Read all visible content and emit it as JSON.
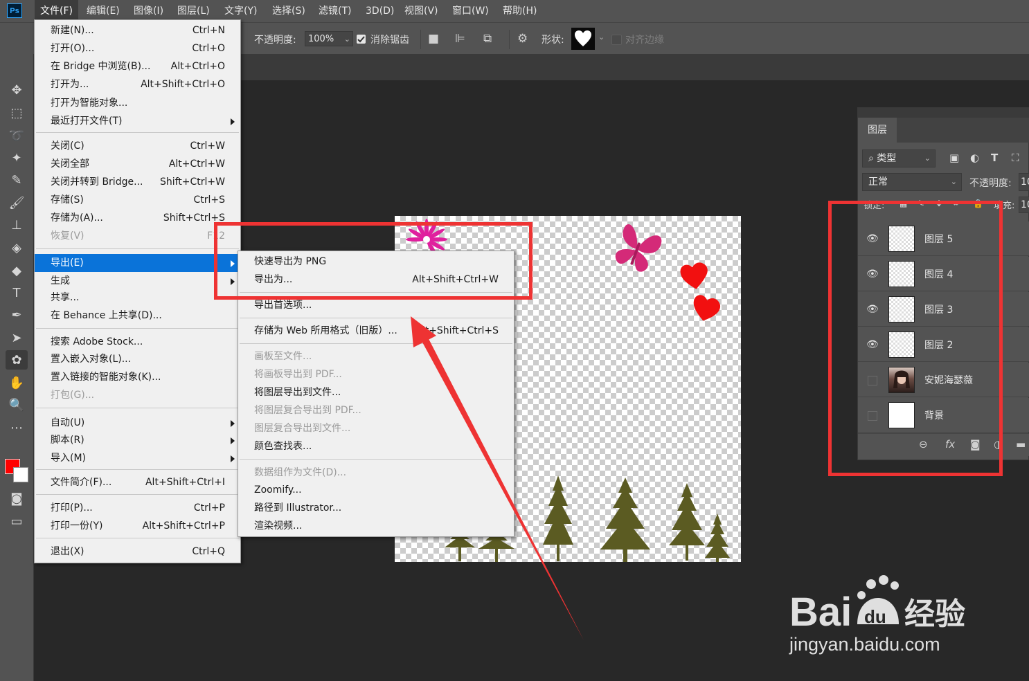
{
  "app": {
    "logo": "Ps"
  },
  "menubar": {
    "items": [
      {
        "label": "文件(F)"
      },
      {
        "label": "编辑(E)"
      },
      {
        "label": "图像(I)"
      },
      {
        "label": "图层(L)"
      },
      {
        "label": "文字(Y)"
      },
      {
        "label": "选择(S)"
      },
      {
        "label": "滤镜(T)"
      },
      {
        "label": "3D(D)"
      },
      {
        "label": "视图(V)"
      },
      {
        "label": "窗口(W)"
      },
      {
        "label": "帮助(H)"
      }
    ],
    "active_index": 0
  },
  "options_bar": {
    "opacity_label": "不透明度:",
    "opacity_value": "100%",
    "antialias_label": "消除锯齿",
    "antialias_checked": true,
    "shape_label": "形状:",
    "align_edges_label": "对齐边缘",
    "align_edges_checked": false
  },
  "file_menu": {
    "items": [
      {
        "label": "新建(N)...",
        "shortcut": "Ctrl+N"
      },
      {
        "label": "打开(O)...",
        "shortcut": "Ctrl+O"
      },
      {
        "label": "在 Bridge 中浏览(B)...",
        "shortcut": "Alt+Ctrl+O"
      },
      {
        "label": "打开为...",
        "shortcut": "Alt+Shift+Ctrl+O"
      },
      {
        "label": "打开为智能对象...",
        "shortcut": ""
      },
      {
        "label": "最近打开文件(T)",
        "shortcut": "",
        "submenu": true
      },
      {
        "label": "关闭(C)",
        "shortcut": "Ctrl+W"
      },
      {
        "label": "关闭全部",
        "shortcut": "Alt+Ctrl+W"
      },
      {
        "label": "关闭并转到 Bridge...",
        "shortcut": "Shift+Ctrl+W"
      },
      {
        "label": "存储(S)",
        "shortcut": "Ctrl+S"
      },
      {
        "label": "存储为(A)...",
        "shortcut": "Shift+Ctrl+S"
      },
      {
        "label": "恢复(V)",
        "shortcut": "F12",
        "disabled": true
      },
      {
        "label": "导出(E)",
        "shortcut": "",
        "submenu": true,
        "highlight": true
      },
      {
        "label": "生成",
        "shortcut": "",
        "submenu": true
      },
      {
        "label": "共享...",
        "shortcut": ""
      },
      {
        "label": "在 Behance 上共享(D)...",
        "shortcut": ""
      },
      {
        "label": "搜索 Adobe Stock...",
        "shortcut": ""
      },
      {
        "label": "置入嵌入对象(L)...",
        "shortcut": ""
      },
      {
        "label": "置入链接的智能对象(K)...",
        "shortcut": ""
      },
      {
        "label": "打包(G)...",
        "shortcut": "",
        "disabled": true
      },
      {
        "label": "自动(U)",
        "shortcut": "",
        "submenu": true
      },
      {
        "label": "脚本(R)",
        "shortcut": "",
        "submenu": true
      },
      {
        "label": "导入(M)",
        "shortcut": "",
        "submenu": true
      },
      {
        "label": "文件简介(F)...",
        "shortcut": "Alt+Shift+Ctrl+I"
      },
      {
        "label": "打印(P)...",
        "shortcut": "Ctrl+P"
      },
      {
        "label": "打印一份(Y)",
        "shortcut": "Alt+Shift+Ctrl+P"
      },
      {
        "label": "退出(X)",
        "shortcut": "Ctrl+Q"
      }
    ]
  },
  "export_menu": {
    "items": [
      {
        "label": "快速导出为 PNG",
        "shortcut": ""
      },
      {
        "label": "导出为...",
        "shortcut": "Alt+Shift+Ctrl+W"
      },
      {
        "label": "导出首选项...",
        "shortcut": ""
      },
      {
        "label": "存储为 Web 所用格式（旧版）...",
        "shortcut": "Alt+Shift+Ctrl+S"
      },
      {
        "label": "画板至文件...",
        "shortcut": "",
        "disabled": true
      },
      {
        "label": "将画板导出到 PDF...",
        "shortcut": "",
        "disabled": true
      },
      {
        "label": "将图层导出到文件...",
        "shortcut": ""
      },
      {
        "label": "将图层复合导出到 PDF...",
        "shortcut": "",
        "disabled": true
      },
      {
        "label": "图层复合导出到文件...",
        "shortcut": "",
        "disabled": true
      },
      {
        "label": "颜色查找表...",
        "shortcut": ""
      },
      {
        "label": "数据组作为文件(D)...",
        "shortcut": "",
        "disabled": true
      },
      {
        "label": "Zoomify...",
        "shortcut": ""
      },
      {
        "label": "路径到 Illustrator...",
        "shortcut": ""
      },
      {
        "label": "渲染视频...",
        "shortcut": ""
      }
    ]
  },
  "layers_panel": {
    "tab": "图层",
    "filter": "类型",
    "blend_mode": "正常",
    "opacity_label": "不透明度:",
    "opacity_value": "10",
    "lock_label": "锁定:",
    "fill_label": "填充:",
    "fill_value": "10",
    "layers": [
      {
        "name": "图层 5",
        "visible": true,
        "thumb": "transparent"
      },
      {
        "name": "图层 4",
        "visible": true,
        "thumb": "transparent"
      },
      {
        "name": "图层 3",
        "visible": true,
        "thumb": "transparent"
      },
      {
        "name": "图层 2",
        "visible": true,
        "thumb": "transparent"
      },
      {
        "name": "安妮海瑟薇",
        "visible": false,
        "thumb": "photo"
      },
      {
        "name": "背景",
        "visible": false,
        "thumb": "white"
      }
    ]
  },
  "watermark": {
    "url": "jingyan.baidu.com"
  },
  "colors": {
    "foreground": "#ff0000",
    "background": "#ffffff",
    "highlight": "#0a73d9",
    "annotation": "#ee3333"
  }
}
